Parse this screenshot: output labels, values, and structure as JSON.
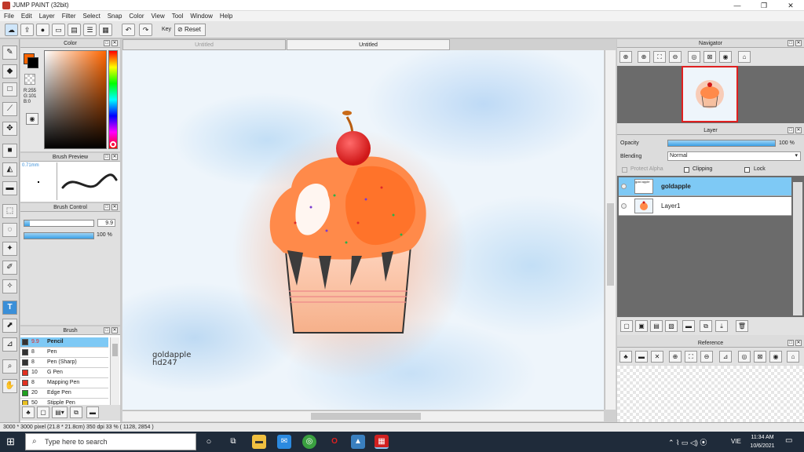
{
  "window": {
    "title": "JUMP PAINT (32bit)"
  },
  "menu": [
    "File",
    "Edit",
    "Layer",
    "Filter",
    "Select",
    "Snap",
    "Color",
    "View",
    "Tool",
    "Window",
    "Help"
  ],
  "toolbar": {
    "key_label": "Key",
    "reset_label": "Reset"
  },
  "color_panel": {
    "title": "Color",
    "r": "R:255",
    "g": "G:101",
    "b": "B:0",
    "fg_color": "#ff6500"
  },
  "brush_preview": {
    "title": "Brush Preview",
    "size": "0.71mm"
  },
  "brush_control": {
    "title": "Brush Control",
    "size_value": "9.9",
    "opacity_value": "100 %",
    "size_fraction": 0.08,
    "opacity_fraction": 1.0
  },
  "brush_panel": {
    "title": "Brush",
    "items": [
      {
        "size": "9.9",
        "name": "Pencil",
        "color": "#333333",
        "selected": true
      },
      {
        "size": "8",
        "name": "Pen",
        "color": "#333333"
      },
      {
        "size": "8",
        "name": "Pen (Sharp)",
        "color": "#333333"
      },
      {
        "size": "10",
        "name": "G Pen",
        "color": "#e03020"
      },
      {
        "size": "8",
        "name": "Mapping Pen",
        "color": "#e03020"
      },
      {
        "size": "20",
        "name": "Edge Pen",
        "color": "#20a020"
      },
      {
        "size": "50",
        "name": "Stipple Pen",
        "color": "#e8c020"
      }
    ]
  },
  "document": {
    "tabs": [
      "Untitled",
      "Untitled"
    ],
    "active_tab": 1
  },
  "canvas": {
    "signature_line1": "goldapple",
    "signature_line2": "hd247"
  },
  "navigator": {
    "title": "Navigator"
  },
  "layer_panel": {
    "title": "Layer",
    "opacity_label": "Opacity",
    "opacity_value": "100 %",
    "opacity_fraction": 1.0,
    "blending_label": "Blending",
    "blending_value": "Normal",
    "protect_alpha": "Protect Alpha",
    "clipping": "Clipping",
    "lock": "Lock",
    "layers": [
      {
        "name": "goldapple",
        "selected": true
      },
      {
        "name": "Layer1",
        "selected": false
      }
    ]
  },
  "reference": {
    "title": "Reference"
  },
  "status": {
    "text": "3000 * 3000 pixel  (21.8 * 21.8cm)  350 dpi  33 %  ( 1128, 2854 )"
  },
  "taskbar": {
    "search_placeholder": "Type here to search",
    "time": "11:34 AM",
    "date": "10/6/2021",
    "lang": "VIE"
  }
}
